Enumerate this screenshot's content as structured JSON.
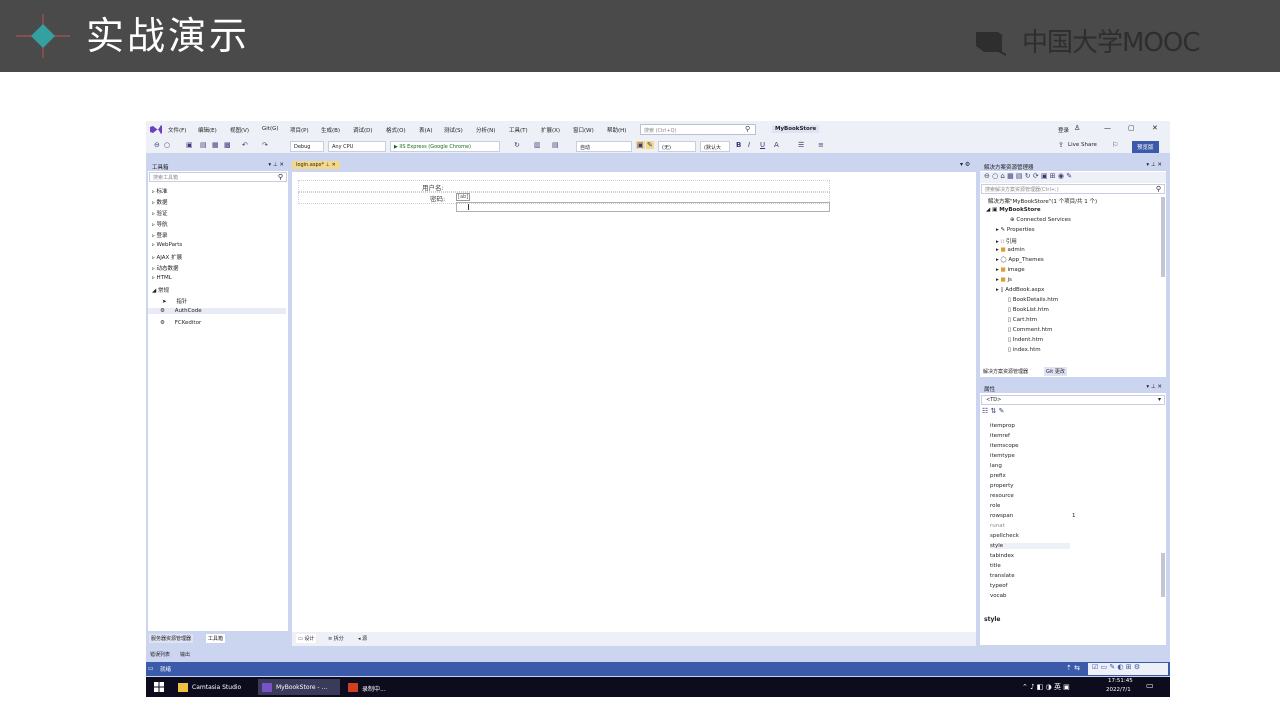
{
  "slide": {
    "title": "实战演示",
    "brand": "中国大学MOOC",
    "brand_color": "#2e2e2e",
    "header_color": "#4a4a4a",
    "logo_color": "#35a0a0"
  },
  "vs": {
    "menu": [
      "文件(F)",
      "编辑(E)",
      "视图(V)",
      "Git(G)",
      "项目(P)",
      "生成(B)",
      "调试(D)",
      "格式(O)",
      "表(A)",
      "测试(S)",
      "分析(N)",
      "工具(T)",
      "扩展(X)",
      "窗口(W)",
      "帮助(H)"
    ],
    "search_placeholder": "搜索 (Ctrl+Q)",
    "solution_name": "MyBookStore",
    "user_label": "登录",
    "toolbar": {
      "config": "Debug",
      "platform": "Any CPU",
      "run_target": "▶ IIS Express (Google Chrome)",
      "auto": "自动",
      "none": "(无)",
      "default_size": "(默认大",
      "live_share": "Live Share",
      "preview_button": "预览版"
    },
    "toolbox": {
      "title": "工具箱",
      "search_placeholder": "搜索工具箱",
      "categories": [
        "▹ 标准",
        "▹ 数据",
        "▹ 验证",
        "▹ 导航",
        "▹ 登录",
        "▹ WebParts",
        "▹ AJAX 扩展",
        "▹ 动态数据",
        "▹ HTML",
        "◢ 常规"
      ],
      "general_items": [
        "指针",
        "AuthCode",
        "FCKeditor"
      ],
      "bottom_tabs": [
        "服务器资源管理器",
        "工具箱"
      ]
    },
    "editor": {
      "tab": "login.aspx*",
      "username_label": "用户名:",
      "password_label": "密码:",
      "password_tag": "[ab]",
      "view_tabs": [
        "设计",
        "拆分",
        "源"
      ]
    },
    "solution_explorer": {
      "title": "解决方案资源管理器",
      "search_placeholder": "搜索解决方案资源管理器(Ctrl+;)",
      "solution_line": "解决方案\"MyBookStore\"(1 个项目/共 1 个)",
      "project": "MyBookStore",
      "items": [
        "Connected Services",
        "Properties",
        "引用",
        "admin",
        "App_Themes",
        "image",
        "js",
        "AddBook.aspx",
        "BookDetails.htm",
        "BookList.htm",
        "Cart.htm",
        "Comment.htm",
        "Indent.htm",
        "index.htm"
      ],
      "bottom_tabs": [
        "解决方案资源管理器",
        "Git 更改"
      ]
    },
    "properties": {
      "title": "属性",
      "selector": "<TD>",
      "rows": [
        "itemprop",
        "itemref",
        "itemscope",
        "itemtype",
        "lang",
        "prefix",
        "property",
        "resource",
        "role",
        "rowspan",
        "runat",
        "spellcheck",
        "style",
        "tabindex",
        "title",
        "translate",
        "typeof",
        "vocab"
      ],
      "rowspan_value": "1",
      "description": "style"
    },
    "bottom": {
      "tabs": [
        "错误列表",
        "输出"
      ],
      "status": "就绪"
    },
    "taskbar": {
      "items": [
        "Camtasia Studio",
        "MyBookStore - ...",
        "录制中..."
      ],
      "time": "17:51:45",
      "date": "2022/7/1"
    }
  }
}
